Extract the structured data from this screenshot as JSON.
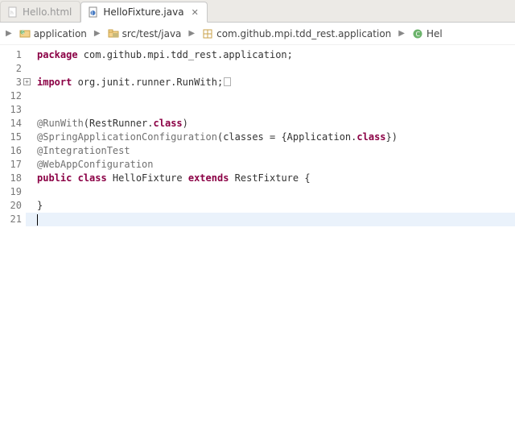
{
  "tabs": [
    {
      "label": "Hello.html",
      "active": false
    },
    {
      "label": "HelloFixture.java",
      "active": true
    }
  ],
  "breadcrumb": {
    "items": [
      {
        "label": "application"
      },
      {
        "label": "src/test/java"
      },
      {
        "label": "com.github.mpi.tdd_rest.application"
      },
      {
        "label": "Hel"
      }
    ]
  },
  "code": {
    "lines": [
      {
        "n": "1",
        "tokens": [
          [
            "kw",
            "package "
          ],
          [
            "pkg",
            "com.github.mpi.tdd_rest.application"
          ],
          [
            "punct",
            ";"
          ]
        ]
      },
      {
        "n": "2",
        "tokens": []
      },
      {
        "n": "3",
        "fold": true,
        "tokens": [
          [
            "kw",
            "import "
          ],
          [
            "pkg",
            "org.junit.runner.RunWith"
          ],
          [
            "punct",
            ";"
          ],
          [
            "box",
            ""
          ]
        ]
      },
      {
        "n": "12",
        "tokens": []
      },
      {
        "n": "13",
        "tokens": []
      },
      {
        "n": "14",
        "tokens": [
          [
            "ann",
            "@RunWith"
          ],
          [
            "punct",
            "("
          ],
          [
            "cls",
            "RestRunner"
          ],
          [
            "punct",
            "."
          ],
          [
            "kw",
            "class"
          ],
          [
            "punct",
            ")"
          ]
        ]
      },
      {
        "n": "15",
        "tokens": [
          [
            "ann",
            "@SpringApplicationConfiguration"
          ],
          [
            "punct",
            "(classes = {"
          ],
          [
            "cls",
            "Application"
          ],
          [
            "punct",
            "."
          ],
          [
            "kw",
            "class"
          ],
          [
            "punct",
            "})"
          ]
        ]
      },
      {
        "n": "16",
        "tokens": [
          [
            "ann",
            "@IntegrationTest"
          ]
        ]
      },
      {
        "n": "17",
        "tokens": [
          [
            "ann",
            "@WebAppConfiguration"
          ]
        ]
      },
      {
        "n": "18",
        "tokens": [
          [
            "kw",
            "public class "
          ],
          [
            "cls",
            "HelloFixture"
          ],
          [
            "kw",
            " extends "
          ],
          [
            "cls",
            "RestFixture"
          ],
          [
            "punct",
            " {"
          ]
        ]
      },
      {
        "n": "19",
        "tokens": []
      },
      {
        "n": "20",
        "tokens": [
          [
            "punct",
            "}"
          ]
        ]
      },
      {
        "n": "21",
        "current": true,
        "tokens": [
          [
            "cursor",
            ""
          ]
        ]
      }
    ]
  }
}
